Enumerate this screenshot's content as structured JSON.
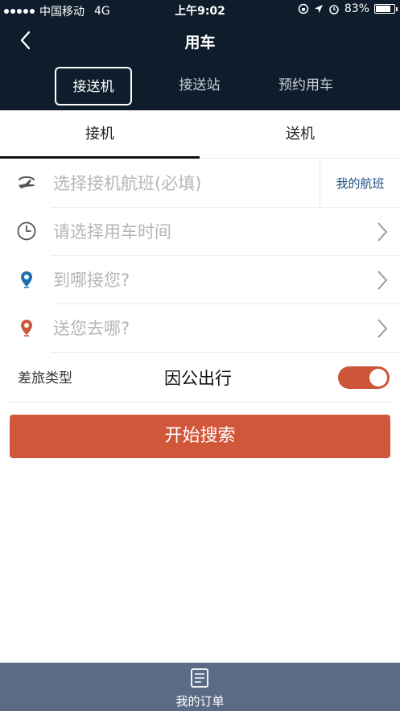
{
  "status_bar": {
    "carrier": "中国移动",
    "network": "4G",
    "time": "上午9:02",
    "battery": "83%"
  },
  "nav": {
    "title": "用车"
  },
  "top_tabs": [
    {
      "label": "接送机",
      "active": true
    },
    {
      "label": "接送站",
      "active": false
    },
    {
      "label": "预约用车",
      "active": false
    }
  ],
  "sub_tabs": [
    {
      "label": "接机",
      "active": true
    },
    {
      "label": "送机",
      "active": false
    }
  ],
  "form": {
    "flight_placeholder": "选择接机航班(必填)",
    "my_flight_label": "我的航班",
    "time_placeholder": "请选择用车时间",
    "pickup_placeholder": "到哪接您?",
    "dropoff_placeholder": "送您去哪?",
    "trip_type_label": "差旅类型",
    "trip_type_value": "因公出行",
    "trip_type_toggle_on": true
  },
  "search_button": "开始搜索",
  "bottom_bar": {
    "orders_label": "我的订单"
  },
  "colors": {
    "header_bg": "#0e1c2b",
    "accent": "#d0573a",
    "link": "#1b4e86",
    "pickup_pin": "#1f6fb0",
    "dropoff_pin": "#cc553a",
    "bottom_bar_bg": "#5b6b85"
  },
  "icons": {
    "back": "chevron-left-icon",
    "flight": "plane-icon",
    "time": "clock-icon",
    "pickup": "location-pin-icon",
    "dropoff": "location-pin-icon",
    "row_arrow": "chevron-right-icon",
    "orders": "order-list-icon"
  }
}
